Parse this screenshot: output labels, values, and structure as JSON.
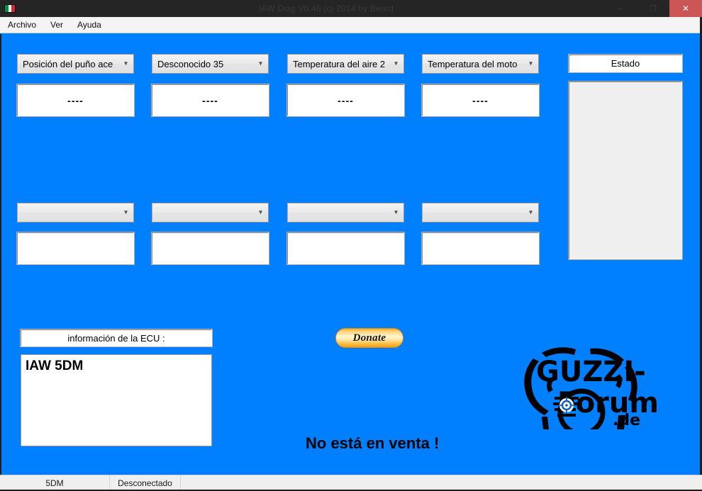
{
  "window": {
    "title": "IAW Diag V0.46  (c) 2014 by Beard",
    "icon_name": "italian-flag-icon",
    "minimize_label": "–",
    "maximize_label": "❐",
    "close_label": "✕",
    "background_color": "#0080ff",
    "titlebar_color": "#252525",
    "close_button_color": "#cc5555"
  },
  "menubar": {
    "items": [
      {
        "label": "Archivo"
      },
      {
        "label": "Ver"
      },
      {
        "label": "Ayuda"
      }
    ]
  },
  "gauges": {
    "top_row": [
      {
        "selector": "Posición del puño ace",
        "value": "----"
      },
      {
        "selector": "Desconocido 35",
        "value": "----"
      },
      {
        "selector": "Temperatura del aire 2",
        "value": "----"
      },
      {
        "selector": "Temperatura del moto",
        "value": "----"
      }
    ],
    "bottom_row": [
      {
        "selector": "",
        "value": ""
      },
      {
        "selector": "",
        "value": ""
      },
      {
        "selector": "",
        "value": ""
      },
      {
        "selector": "",
        "value": ""
      }
    ]
  },
  "status_panel": {
    "heading": "Estado",
    "entries": ""
  },
  "ecu_panel": {
    "heading": "información de la ECU  :",
    "content": "IAW 5DM"
  },
  "donate": {
    "label": "Donate"
  },
  "notice": {
    "text": "No está en venta !"
  },
  "logo": {
    "name": "guzzi-forum-logo",
    "line1": "GUZZI-",
    "line2": "Forum",
    "line3": ".de"
  },
  "statusbar": {
    "cells": [
      {
        "label": "5DM"
      },
      {
        "label": "Desconectado"
      },
      {
        "label": ""
      }
    ]
  }
}
